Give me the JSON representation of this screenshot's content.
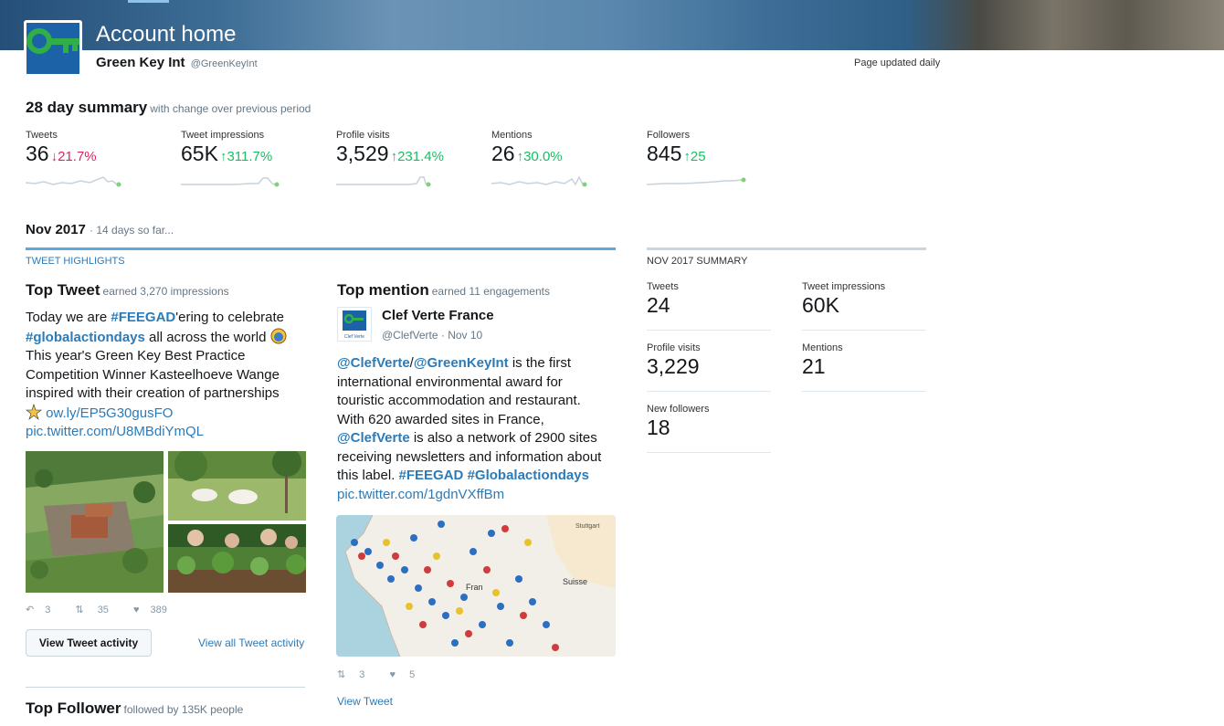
{
  "header": {
    "title": "Account home",
    "account_name": "Green Key Int",
    "handle": "@GreenKeyInt",
    "updated": "Page updated daily"
  },
  "summary": {
    "title": "28 day summary",
    "subtitle": "with change over previous period",
    "metrics": [
      {
        "label": "Tweets",
        "value": "36",
        "change": "↓21.7%",
        "direction": "down"
      },
      {
        "label": "Tweet impressions",
        "value": "65K",
        "change": "↑311.7%",
        "direction": "up"
      },
      {
        "label": "Profile visits",
        "value": "3,529",
        "change": "↑231.4%",
        "direction": "up"
      },
      {
        "label": "Mentions",
        "value": "26",
        "change": "↑30.0%",
        "direction": "up"
      },
      {
        "label": "Followers",
        "value": "845",
        "change": "↑25",
        "direction": "up"
      }
    ]
  },
  "month": {
    "title": "Nov 2017",
    "subtitle": "· 14 days so far..."
  },
  "highlights": {
    "heading": "TWEET HIGHLIGHTS",
    "top_tweet": {
      "title": "Top Tweet",
      "subtitle": "earned 3,270 impressions",
      "text_1": "Today we are ",
      "tag_1": "#FEEGAD",
      "text_2": "'ering to celebrate",
      "tag_2": "#globalactiondays",
      "text_3": " all across the world ",
      "line_3": "This year's Green Key Best Practice",
      "line_4": "Competition Winner Kasteelhoeve Wange",
      "line_5": "inspired with their creation of partnerships",
      "link_1": "ow.ly/EP5G30gusFO",
      "link_2": "pic.twitter.com/U8MBdiYmQL",
      "replies": "3",
      "retweets": "35",
      "likes": "389",
      "button": "View Tweet activity",
      "all_link": "View all Tweet activity"
    },
    "top_mention": {
      "title": "Top mention",
      "subtitle": "earned 11 engagements",
      "name": "Clef Verte France",
      "handle": "@ClefVerte · Nov 10",
      "avatar_text": "Clef Verte",
      "mention_1": "@ClefVerte",
      "slash": "/",
      "mention_2": "@GreenKeyInt",
      "text_1": " is the first",
      "line_2": "international environmental award for",
      "line_3": "touristic accommodation and restaurant.",
      "line_4": "With 620 awarded sites in France,",
      "mention_3": "@ClefVerte",
      "text_5": " is also a network of 2900 sites",
      "line_6": "receiving newsletters and information about",
      "line_7a": "this label. ",
      "tag_1": "#FEEGAD",
      "tag_2": "#Globalactiondays",
      "link": "pic.twitter.com/1gdnVXffBm",
      "map_label_1": "Suisse",
      "map_label_2": "Stuttgart",
      "map_label_3": "Fran",
      "retweets": "3",
      "likes": "5",
      "view_link": "View Tweet"
    },
    "top_follower": {
      "title": "Top Follower",
      "subtitle": "followed by 135K people"
    }
  },
  "nov_summary": {
    "heading": "NOV 2017 SUMMARY",
    "items": [
      {
        "label": "Tweets",
        "value": "24"
      },
      {
        "label": "Tweet impressions",
        "value": "60K"
      },
      {
        "label": "Profile visits",
        "value": "3,229"
      },
      {
        "label": "Mentions",
        "value": "21"
      },
      {
        "label": "New followers",
        "value": "18"
      }
    ]
  },
  "colors": {
    "link": "#2b7bb9",
    "up": "#17bf63",
    "down": "#e0245e",
    "highlight_bar": "#5ea8e0"
  }
}
